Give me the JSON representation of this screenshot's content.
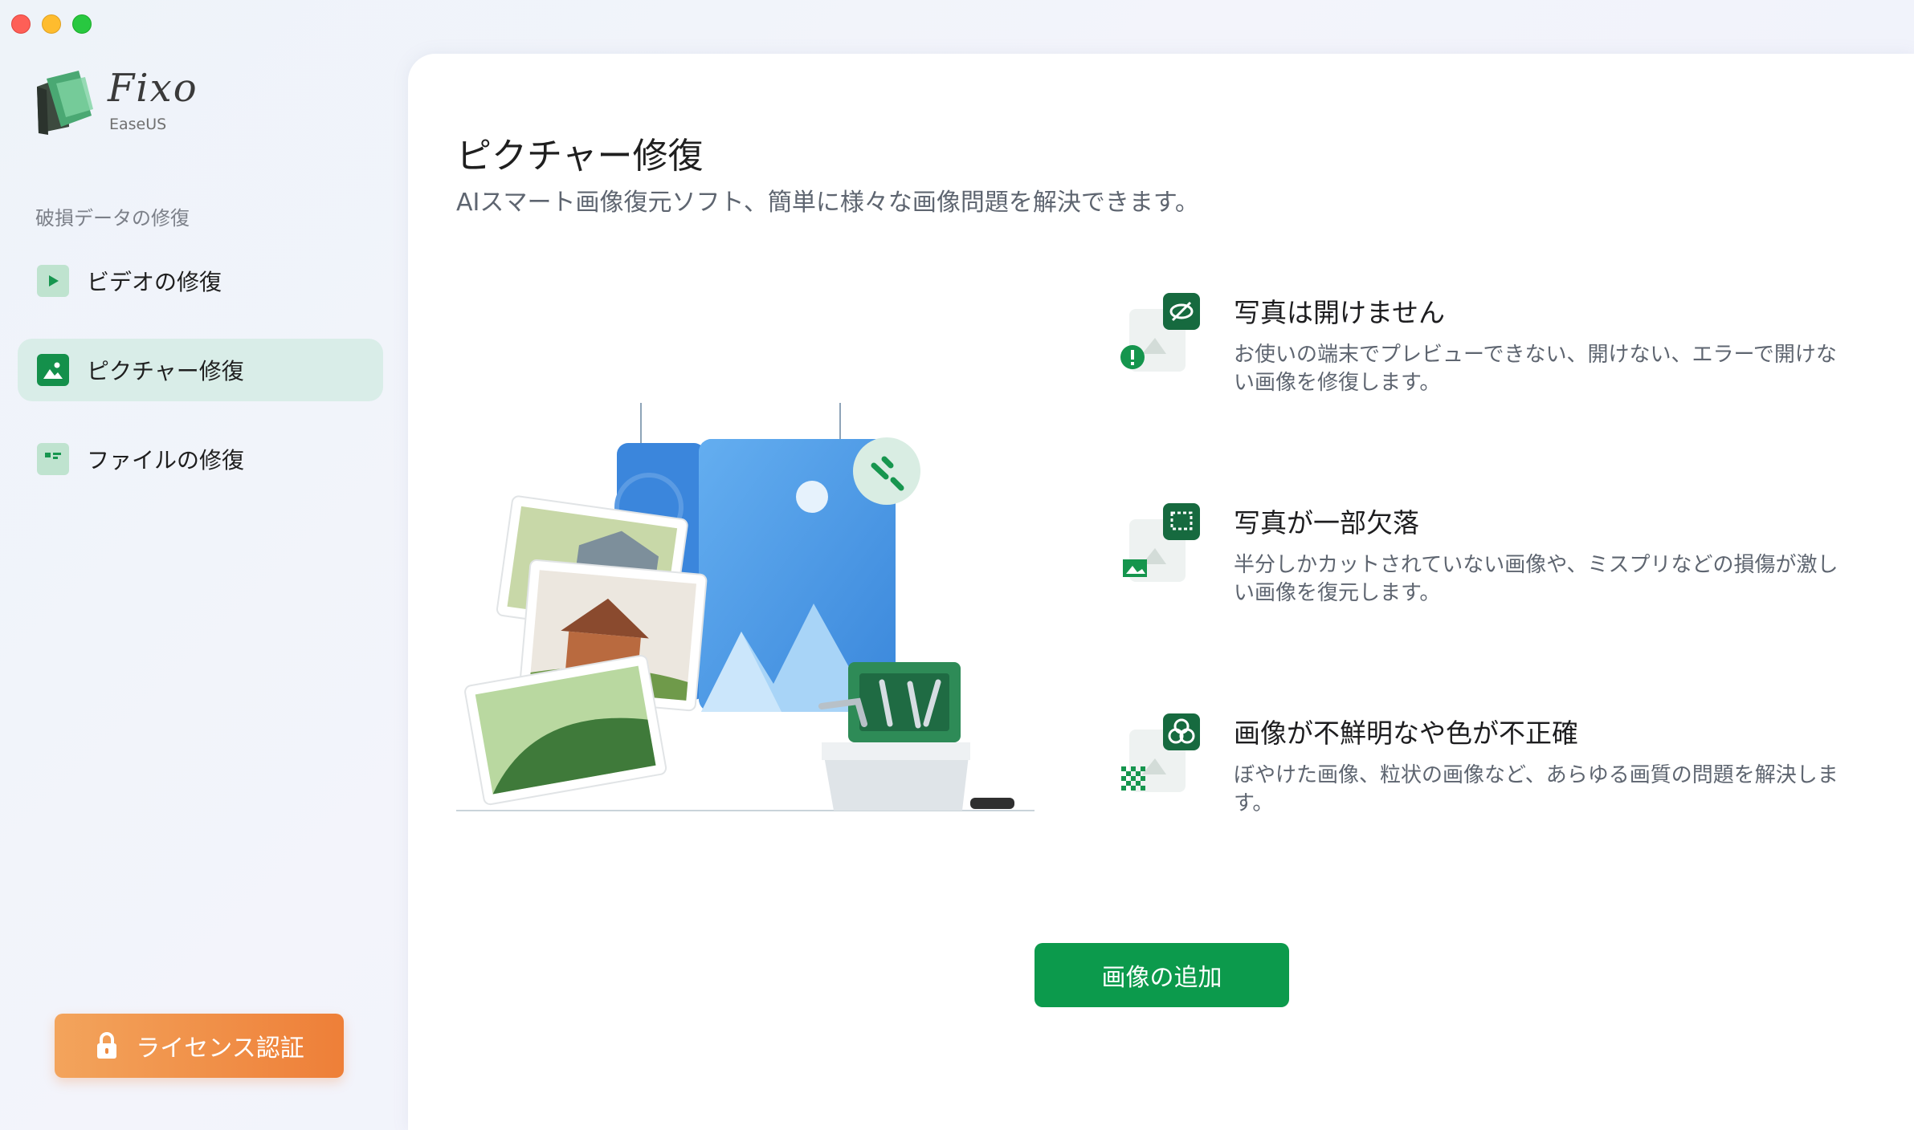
{
  "window": {
    "controls": [
      "close",
      "minimize",
      "zoom"
    ]
  },
  "sidebar": {
    "logo_text": "Fixo",
    "logo_sub": "EaseUS",
    "section_label": "破損データの修復",
    "items": [
      {
        "label": "ビデオの修復",
        "icon": "video-play-icon",
        "active": false
      },
      {
        "label": "ピクチャー修復",
        "icon": "picture-icon",
        "active": true
      },
      {
        "label": "ファイルの修復",
        "icon": "file-document-icon",
        "active": false
      }
    ],
    "license_button": "ライセンス認証"
  },
  "main": {
    "title": "ピクチャー修復",
    "description": "AIスマート画像復元ソフト、簡単に様々な画像問題を解決できます。",
    "features": [
      {
        "title": "写真は開けません",
        "description": "お使いの端末でプレビューできない、開けない、エラーで開けない画像を修復します。",
        "icon": "hidden-eye-warning-icon"
      },
      {
        "title": "写真が一部欠落",
        "description": "半分しかカットされていない画像や、ミスプリなどの損傷が激しい画像を復元します。",
        "icon": "crop-missing-icon"
      },
      {
        "title": "画像が不鮮明なや色が不正確",
        "description": "ぼやけた画像、粒状の画像など、あらゆる画質の問題を解決します。",
        "icon": "color-blur-icon"
      }
    ],
    "add_button": "画像の追加"
  },
  "colors": {
    "accent_green": "#0c9a4c",
    "active_nav_bg": "#d9ede8",
    "license_orange": "#ee7f38"
  }
}
